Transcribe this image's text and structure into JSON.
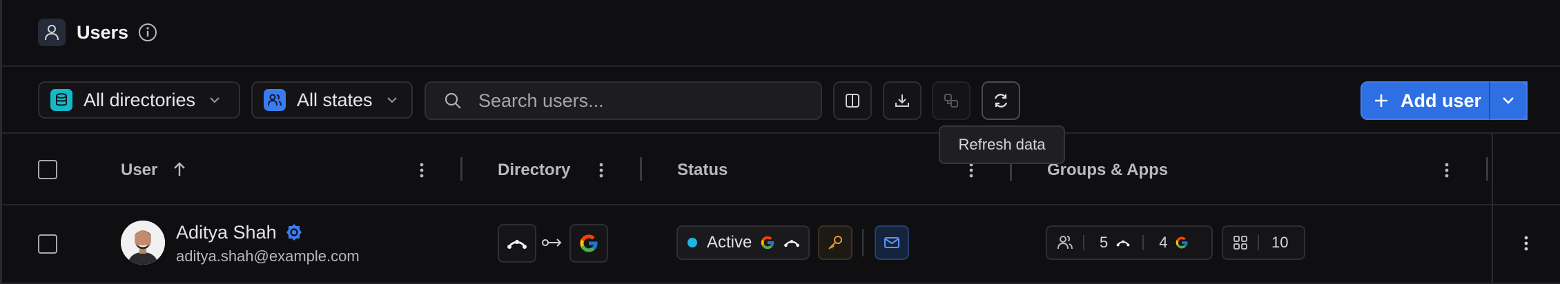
{
  "header": {
    "title": "Users",
    "user_icon": "user-icon",
    "info_icon": "info-icon"
  },
  "toolbar": {
    "directories_label": "All directories",
    "states_label": "All states",
    "search_placeholder": "Search users...",
    "add_user_label": "Add user",
    "tooltip": "Refresh data",
    "icons": [
      "columns-icon",
      "download-icon",
      "merge-icon",
      "refresh-icon"
    ]
  },
  "table": {
    "columns": {
      "user": "User",
      "directory": "Directory",
      "status": "Status",
      "groups_apps": "Groups & Apps"
    },
    "rows": [
      {
        "name": "Aditya Shah",
        "email": "aditya.shah@example.com",
        "status": "Active",
        "groups_count_1": "5",
        "groups_count_2": "4",
        "apps_count": "10"
      }
    ]
  },
  "colors": {
    "accent": "#2f6fe4",
    "status_active": "#1fb6e6",
    "key_orange": "#e89a2e",
    "directories_badge": "#14b8c8",
    "states_badge": "#3b7bf0"
  }
}
